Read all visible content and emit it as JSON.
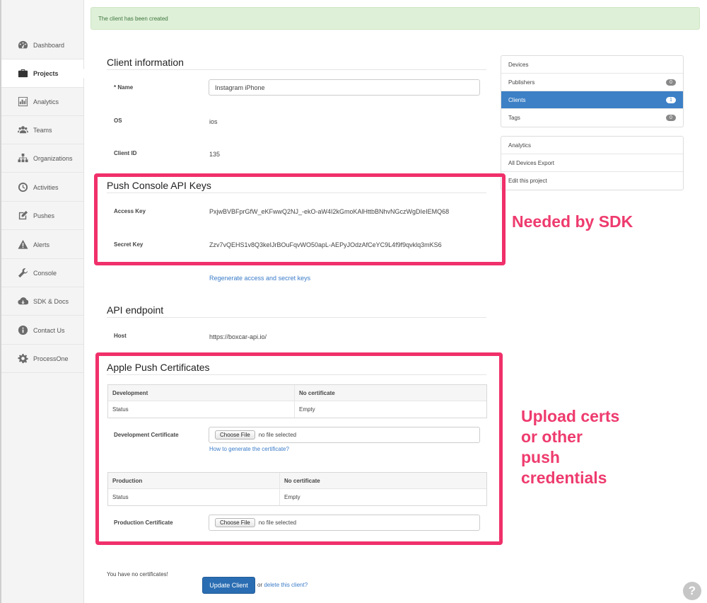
{
  "alert": {
    "message": "The client has been created"
  },
  "sidebar": {
    "items": [
      {
        "label": "Dashboard",
        "icon": "dashboard-icon"
      },
      {
        "label": "Projects",
        "icon": "briefcase-icon",
        "active": true
      },
      {
        "label": "Analytics",
        "icon": "bar-chart-icon"
      },
      {
        "label": "Teams",
        "icon": "users-icon"
      },
      {
        "label": "Organizations",
        "icon": "sitemap-icon"
      },
      {
        "label": "Activities",
        "icon": "clock-icon"
      },
      {
        "label": "Pushes",
        "icon": "edit-icon"
      },
      {
        "label": "Alerts",
        "icon": "warning-icon"
      },
      {
        "label": "Console",
        "icon": "wrench-icon"
      },
      {
        "label": "SDK & Docs",
        "icon": "cloud-download-icon"
      },
      {
        "label": "Contact Us",
        "icon": "info-icon"
      },
      {
        "label": "ProcessOne",
        "icon": "gear-icon"
      }
    ]
  },
  "client_info": {
    "title": "Client information",
    "name_required": "*",
    "name_label": "Name",
    "name_value": "Instagram iPhone",
    "os_label": "OS",
    "os_value": "ios",
    "client_id_label": "Client ID",
    "client_id_value": "135"
  },
  "api_keys": {
    "title": "Push Console API Keys",
    "access_label": "Access Key",
    "access_value": "PxjwBVBFprGfW_eKFwwQ2NJ_-ekO-aW4I2kGmoKAlHttbBNhvNGczWgDIeIEMQ68",
    "secret_label": "Secret Key",
    "secret_value": "Zzv7vQEHS1v8Q3keIJrBOuFqvWO50apL-AEPyJOdzAfCeYC9L4f9f9qvklq3mKS6",
    "regenerate_link": "Regenerate access and secret keys"
  },
  "endpoint": {
    "title": "API endpoint",
    "host_label": "Host",
    "host_value": "https://boxcar-api.io/"
  },
  "certs": {
    "title": "Apple Push Certificates",
    "dev_table": {
      "header": [
        "Development",
        "No certificate"
      ],
      "row": [
        "Status",
        "Empty"
      ]
    },
    "dev_cert_label": "Development Certificate",
    "choose_file": "Choose File",
    "no_file": "no file selected",
    "how_to_link": "How to generate the certificate?",
    "prod_table": {
      "header": [
        "Production",
        "No certificate"
      ],
      "row": [
        "Status",
        "Empty"
      ]
    },
    "prod_cert_label": "Production Certificate"
  },
  "footer": {
    "no_certs": "You have no certificates!",
    "update_button": "Update Client",
    "or_text": "or",
    "delete_link": "delete this client?"
  },
  "right_panel": {
    "nav": [
      {
        "label": "Devices"
      },
      {
        "label": "Publishers",
        "count": "0"
      },
      {
        "label": "Clients",
        "count": "1",
        "active": true
      },
      {
        "label": "Tags",
        "count": "0"
      }
    ],
    "actions": [
      {
        "label": "Analytics"
      },
      {
        "label": "All Devices Export"
      },
      {
        "label": "Edit this project"
      }
    ]
  },
  "annotations": {
    "sdk_note": "Needed by SDK",
    "upload_note_lines": [
      "Upload certs",
      "or other",
      "push",
      "credentials"
    ],
    "color": "#f0306a"
  },
  "help_icon": "?"
}
